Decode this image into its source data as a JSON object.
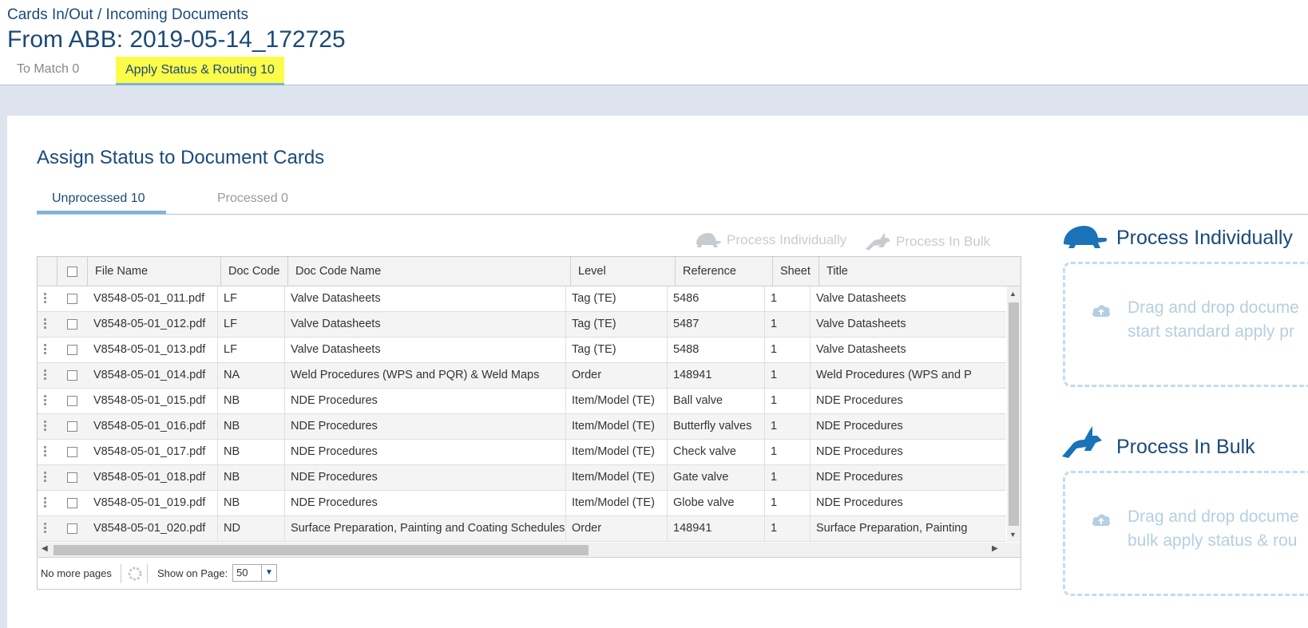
{
  "header": {
    "breadcrumb": "Cards In/Out / Incoming Documents",
    "title": "From ABB: 2019-05-14_172725",
    "tabs": [
      {
        "label": "To Match 0"
      },
      {
        "label": "Apply Status & Routing 10"
      }
    ]
  },
  "section": {
    "title": "Assign Status to Document Cards",
    "tabs": [
      {
        "label": "Unprocessed 10"
      },
      {
        "label": "Processed 0"
      }
    ]
  },
  "toolbar": {
    "process_individually": "Process Individually",
    "process_in_bulk": "Process In Bulk"
  },
  "grid": {
    "columns": [
      "File Name",
      "Doc Code",
      "Doc Code Name",
      "Level",
      "Reference",
      "Sheet",
      "Title"
    ],
    "rows": [
      [
        "V8548-05-01_011.pdf",
        "LF",
        "Valve Datasheets",
        "Tag (TE)",
        "5486",
        "1",
        "Valve Datasheets"
      ],
      [
        "V8548-05-01_012.pdf",
        "LF",
        "Valve Datasheets",
        "Tag (TE)",
        "5487",
        "1",
        "Valve Datasheets"
      ],
      [
        "V8548-05-01_013.pdf",
        "LF",
        "Valve Datasheets",
        "Tag (TE)",
        "5488",
        "1",
        "Valve Datasheets"
      ],
      [
        "V8548-05-01_014.pdf",
        "NA",
        "Weld Procedures (WPS and PQR) & Weld Maps",
        "Order",
        "148941",
        "1",
        "Weld Procedures (WPS and P"
      ],
      [
        "V8548-05-01_015.pdf",
        "NB",
        "NDE Procedures",
        "Item/Model (TE)",
        "Ball valve",
        "1",
        "NDE Procedures"
      ],
      [
        "V8548-05-01_016.pdf",
        "NB",
        "NDE Procedures",
        "Item/Model (TE)",
        "Butterfly valves",
        "1",
        "NDE Procedures"
      ],
      [
        "V8548-05-01_017.pdf",
        "NB",
        "NDE Procedures",
        "Item/Model (TE)",
        "Check valve",
        "1",
        "NDE Procedures"
      ],
      [
        "V8548-05-01_018.pdf",
        "NB",
        "NDE Procedures",
        "Item/Model (TE)",
        "Gate valve",
        "1",
        "NDE Procedures"
      ],
      [
        "V8548-05-01_019.pdf",
        "NB",
        "NDE Procedures",
        "Item/Model (TE)",
        "Globe valve",
        "1",
        "NDE Procedures"
      ],
      [
        "V8548-05-01_020.pdf",
        "ND",
        "Surface Preparation, Painting and Coating Schedules",
        "Order",
        "148941",
        "1",
        "Surface Preparation, Painting"
      ]
    ],
    "footer": {
      "pages": "No more pages",
      "show_label": "Show on Page:",
      "page_size": "50"
    }
  },
  "side": {
    "individual": {
      "title": "Process Individually",
      "line1": "Drag and drop docume",
      "line2": "start standard apply pr"
    },
    "bulk": {
      "title": "Process In Bulk",
      "line1": "Drag and drop docume",
      "line2": "bulk apply status & rou"
    }
  },
  "colors": {
    "primary": "#1b4a78",
    "highlight": "#fbfb4a",
    "tab_underline": "#7fb3d8",
    "band": "#dde4ee"
  }
}
